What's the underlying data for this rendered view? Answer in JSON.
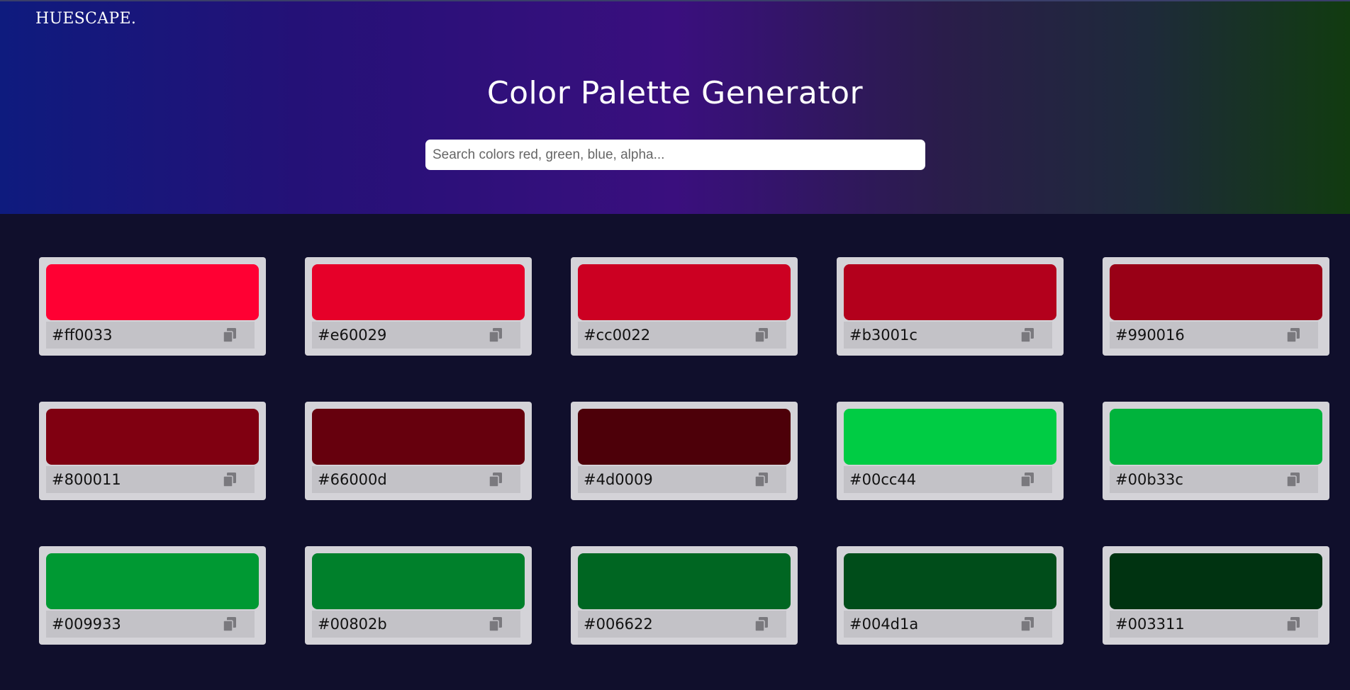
{
  "header": {
    "brand": "HUESCAPE.",
    "title": "Color Palette Generator",
    "search_placeholder": "Search colors red, green, blue, alpha..."
  },
  "palette": [
    {
      "hex": "#ff0033",
      "icon": "copy-icon"
    },
    {
      "hex": "#e60029",
      "icon": "copy-icon"
    },
    {
      "hex": "#cc0022",
      "icon": "copy-icon"
    },
    {
      "hex": "#b3001c",
      "icon": "copy-icon"
    },
    {
      "hex": "#990016",
      "icon": "copy-icon"
    },
    {
      "hex": "#800011",
      "icon": "copy-icon"
    },
    {
      "hex": "#66000d",
      "icon": "copy-icon"
    },
    {
      "hex": "#4d0009",
      "icon": "copy-icon"
    },
    {
      "hex": "#00cc44",
      "icon": "copy-icon"
    },
    {
      "hex": "#00b33c",
      "icon": "copy-icon"
    },
    {
      "hex": "#009933",
      "icon": "copy-icon"
    },
    {
      "hex": "#00802b",
      "icon": "copy-icon"
    },
    {
      "hex": "#006622",
      "icon": "copy-icon"
    },
    {
      "hex": "#004d1a",
      "icon": "copy-icon"
    },
    {
      "hex": "#003311",
      "icon": "copy-icon"
    }
  ]
}
